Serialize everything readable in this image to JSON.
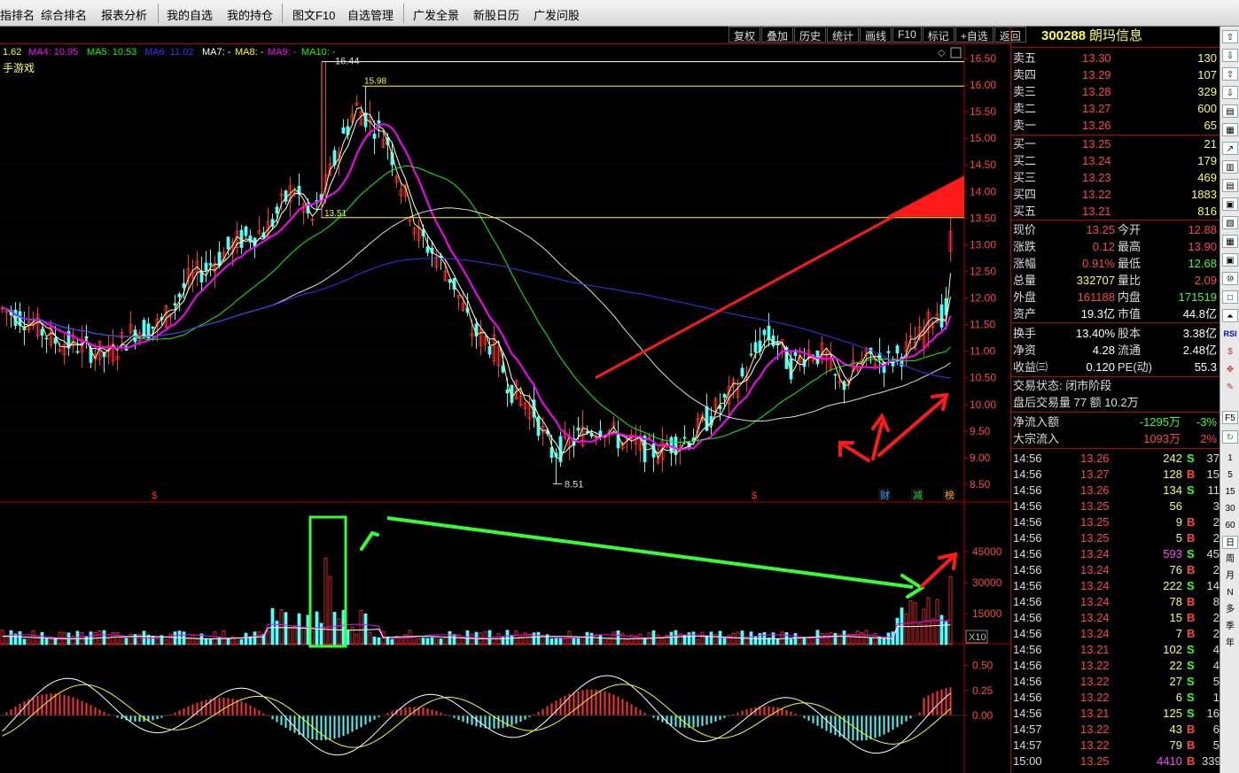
{
  "topbar": {
    "items": [
      "指排名",
      "综合排名",
      "报表分析",
      "我的自选",
      "我的持仓",
      "图文F10",
      "自选管理",
      "广发全景",
      "新股日历",
      "广发问股"
    ]
  },
  "ma_legend": [
    {
      "label": "1.62",
      "color": "#ffff00"
    },
    {
      "label": "MA4: 10.95",
      "color": "#ff00ff"
    },
    {
      "label": "MA5: 10.53",
      "color": "#00ff00"
    },
    {
      "label": "MA6: 11.02",
      "color": "#3333ff"
    },
    {
      "label": "MA7: -",
      "color": "#ffffff"
    },
    {
      "label": "MA8: -",
      "color": "#ffff00"
    },
    {
      "label": "MA9: -",
      "color": "#ff00ff"
    },
    {
      "label": "MA10: -",
      "color": "#00ff00"
    }
  ],
  "sector": "手游戏",
  "toolbar": [
    "复权",
    "叠加",
    "历史",
    "统计",
    "画线",
    "F10",
    "标记",
    "+自选",
    "返回"
  ],
  "price_axis": [
    "16.50",
    "16.00",
    "15.50",
    "15.00",
    "14.50",
    "14.00",
    "13.50",
    "13.00",
    "12.50",
    "12.00",
    "11.50",
    "11.00",
    "10.50",
    "10.00",
    "9.50",
    "9.00",
    "8.50"
  ],
  "vol_axis": [
    "45000",
    "30000",
    "15000"
  ],
  "vol_unit": "X10",
  "macd_axis": [
    "0.50",
    "0.25",
    "0.00"
  ],
  "annotations": {
    "high": "16.44",
    "low": "8.51",
    "mark1": "15.98",
    "mark2": "13.51"
  },
  "event_marks": [
    "$",
    "$",
    "财",
    "减",
    "榜"
  ],
  "stock": {
    "code": "300288",
    "name": "朗玛信息"
  },
  "sell": [
    {
      "label": "卖五",
      "price": "13.30",
      "vol": "130"
    },
    {
      "label": "卖四",
      "price": "13.29",
      "vol": "107"
    },
    {
      "label": "卖三",
      "price": "13.28",
      "vol": "329"
    },
    {
      "label": "卖二",
      "price": "13.27",
      "vol": "600"
    },
    {
      "label": "卖一",
      "price": "13.26",
      "vol": "65"
    }
  ],
  "buy": [
    {
      "label": "买一",
      "price": "13.25",
      "vol": "21"
    },
    {
      "label": "买二",
      "price": "13.24",
      "vol": "179"
    },
    {
      "label": "买三",
      "price": "13.23",
      "vol": "469"
    },
    {
      "label": "买四",
      "price": "13.22",
      "vol": "1883"
    },
    {
      "label": "买五",
      "price": "13.21",
      "vol": "816"
    }
  ],
  "stats": [
    {
      "l1": "现价",
      "v1": "13.25",
      "l2": "今开",
      "v2": "12.88"
    },
    {
      "l1": "涨跌",
      "v1": "0.12",
      "l2": "最高",
      "v2": "13.90"
    },
    {
      "l1": "涨幅",
      "v1": "0.91%",
      "l2": "最低",
      "v2": "12.68"
    },
    {
      "l1": "总量",
      "v1": "332707",
      "l2": "量比",
      "v2": "2.09"
    },
    {
      "l1": "外盘",
      "v1": "161188",
      "l2": "内盘",
      "v2": "171519"
    },
    {
      "l1": "资产",
      "v1": "19.3亿",
      "l2": "市值",
      "v2": "44.8亿"
    },
    {
      "l1": "换手",
      "v1": "13.40%",
      "l2": "股本",
      "v2": "3.38亿"
    },
    {
      "l1": "净资",
      "v1": "4.28",
      "l2": "流通",
      "v2": "2.48亿"
    },
    {
      "l1": "收益㈢",
      "v1": "0.120",
      "l2": "PE(动)",
      "v2": "55.3"
    }
  ],
  "trade_state": "交易状态: 闭市阶段",
  "after_hours": "盘后交易量 77 额 10.2万",
  "flow": [
    {
      "label": "净流入额",
      "v1": "-1295万",
      "v2": "-3%"
    },
    {
      "label": "大宗流入",
      "v1": "1093万",
      "v2": "2%"
    }
  ],
  "ticks": [
    {
      "t": "14:56",
      "p": "13.26",
      "v": "242",
      "s": "S",
      "n": "37"
    },
    {
      "t": "14:56",
      "p": "13.27",
      "v": "128",
      "s": "B",
      "n": "15"
    },
    {
      "t": "14:56",
      "p": "13.26",
      "v": "134",
      "s": "S",
      "n": "11"
    },
    {
      "t": "14:56",
      "p": "13.25",
      "v": "56",
      "s": "",
      "n": "3"
    },
    {
      "t": "14:56",
      "p": "13.25",
      "v": "9",
      "s": "B",
      "n": "2"
    },
    {
      "t": "14:56",
      "p": "13.25",
      "v": "5",
      "s": "B",
      "n": "2"
    },
    {
      "t": "14:56",
      "p": "13.24",
      "v": "593",
      "s": "S",
      "n": "45"
    },
    {
      "t": "14:56",
      "p": "13.24",
      "v": "76",
      "s": "B",
      "n": "2"
    },
    {
      "t": "14:56",
      "p": "13.24",
      "v": "222",
      "s": "S",
      "n": "14"
    },
    {
      "t": "14:56",
      "p": "13.24",
      "v": "78",
      "s": "B",
      "n": "8"
    },
    {
      "t": "14:56",
      "p": "13.24",
      "v": "15",
      "s": "B",
      "n": "2"
    },
    {
      "t": "14:56",
      "p": "13.24",
      "v": "7",
      "s": "B",
      "n": "2"
    },
    {
      "t": "14:56",
      "p": "13.21",
      "v": "102",
      "s": "S",
      "n": "4"
    },
    {
      "t": "14:56",
      "p": "13.22",
      "v": "22",
      "s": "S",
      "n": "4"
    },
    {
      "t": "14:56",
      "p": "13.22",
      "v": "27",
      "s": "S",
      "n": "5"
    },
    {
      "t": "14:56",
      "p": "13.22",
      "v": "6",
      "s": "S",
      "n": "1"
    },
    {
      "t": "14:56",
      "p": "13.21",
      "v": "125",
      "s": "S",
      "n": "16"
    },
    {
      "t": "14:57",
      "p": "13.22",
      "v": "43",
      "s": "B",
      "n": "6"
    },
    {
      "t": "14:57",
      "p": "13.22",
      "v": "79",
      "s": "B",
      "n": "5"
    },
    {
      "t": "15:00",
      "p": "13.25",
      "v": "4410",
      "s": "B",
      "n": "339"
    }
  ],
  "iconbar": {
    "periods": [
      "1",
      "5",
      "15",
      "30",
      "60",
      "日",
      "周",
      "月",
      "N",
      "多",
      "季",
      "年"
    ],
    "tools": [
      "F5",
      "RSI"
    ]
  },
  "colors": {
    "up": "#ff3333",
    "down": "#54fcfc",
    "ma4": "#ff00ff",
    "ma5": "#00ff00",
    "ma6": "#3333ff",
    "grid": "#800000"
  }
}
